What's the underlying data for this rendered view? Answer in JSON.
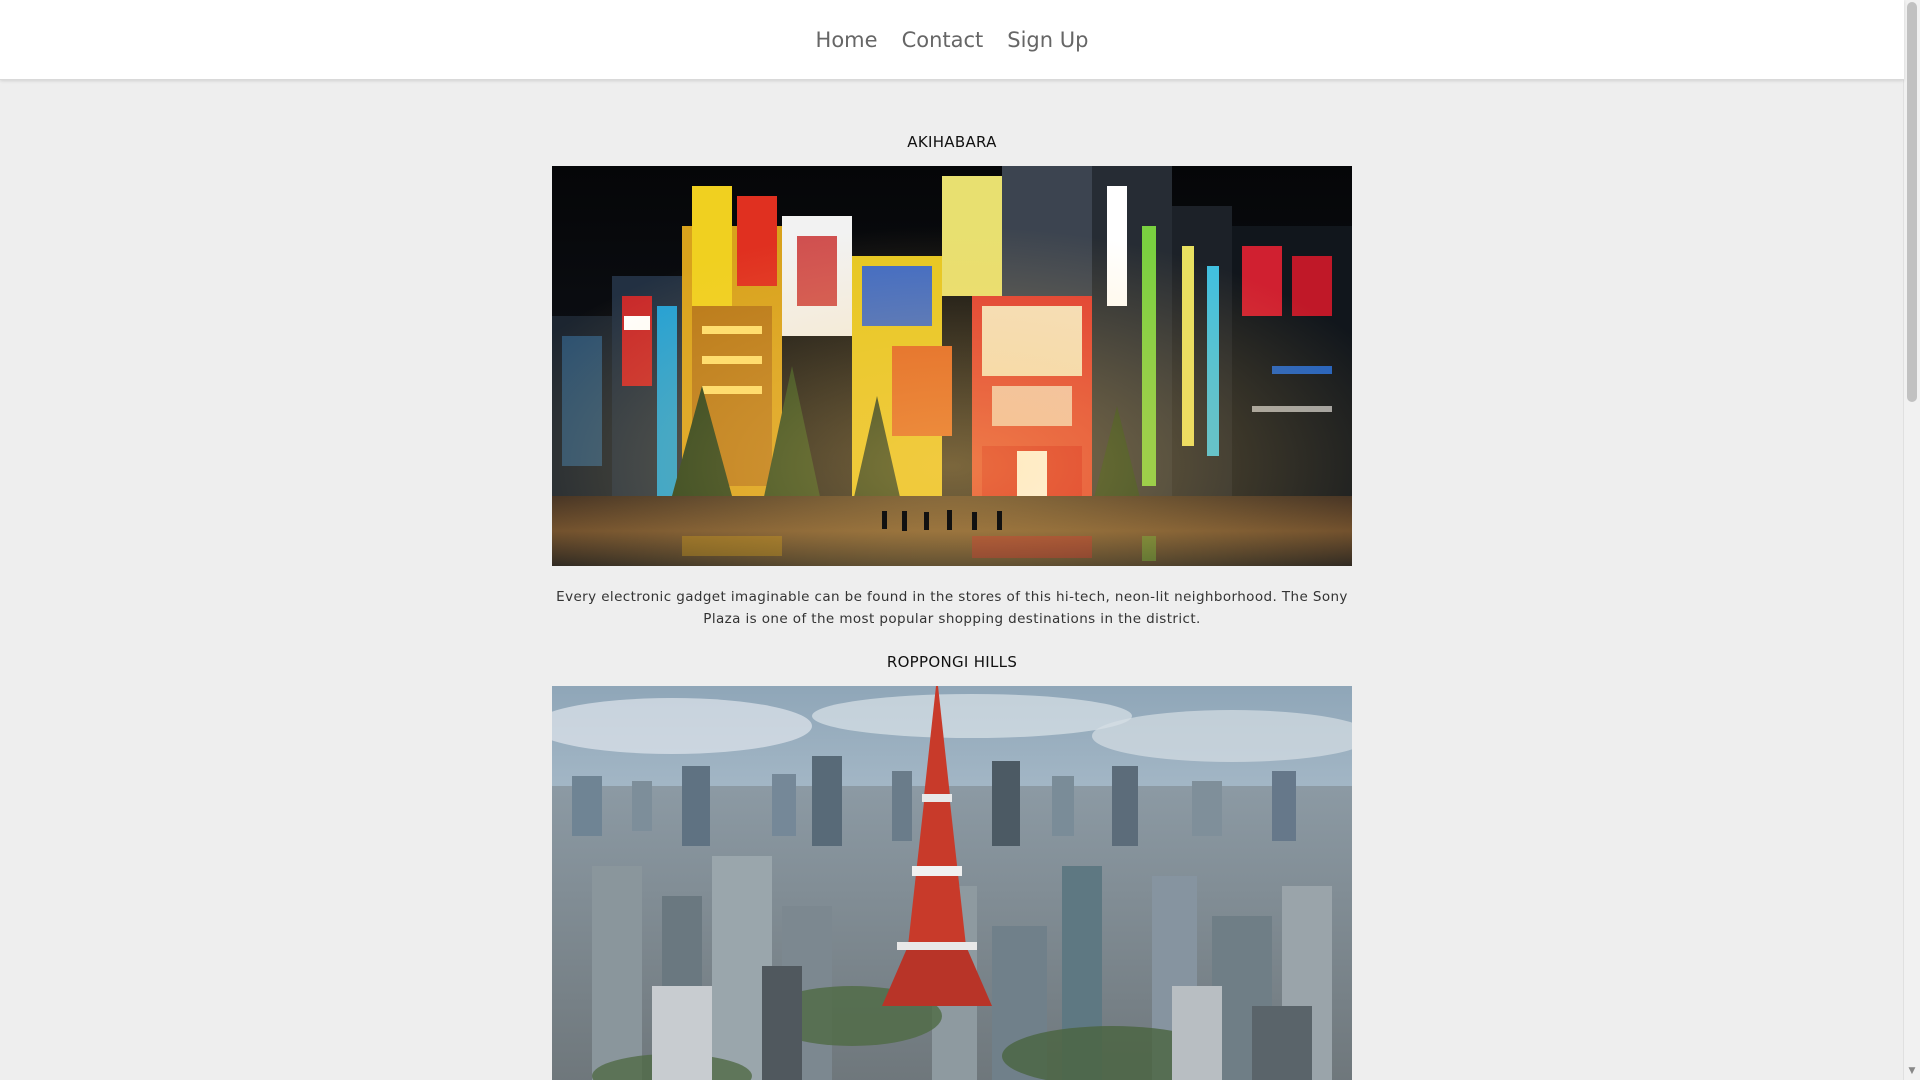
{
  "nav": {
    "items": [
      {
        "label": "Home"
      },
      {
        "label": "Contact"
      },
      {
        "label": "Sign Up"
      }
    ]
  },
  "sections": [
    {
      "title": "AKIHABARA",
      "description": "Every electronic gadget imaginable can be found in the stores of this hi-tech, neon-lit neighborhood. The Sony Plaza is one of the most popular shopping destinations in the district."
    },
    {
      "title": "ROPPONGI HILLS"
    }
  ],
  "colors": {
    "background": "#eeeeee",
    "navbar": "#ffffff",
    "nav_text": "#666666",
    "title_text": "#111111",
    "body_text": "#333333"
  }
}
